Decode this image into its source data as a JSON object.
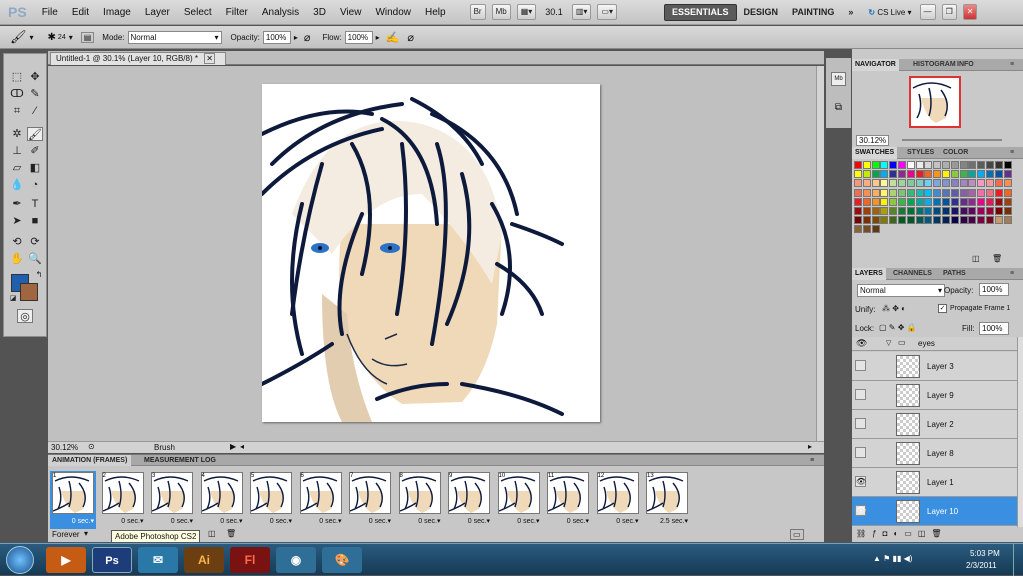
{
  "app": {
    "logo": "PS"
  },
  "menu": [
    "File",
    "Edit",
    "Image",
    "Layer",
    "Select",
    "Filter",
    "Analysis",
    "3D",
    "View",
    "Window",
    "Help"
  ],
  "menubar_buttons": {
    "bridge": "Br",
    "mini_bridge": "Mb",
    "zoom": "30.1",
    "workspaces": [
      "ESSENTIALS",
      "DESIGN",
      "PAINTING"
    ],
    "more": "»",
    "cs_live": "CS Live"
  },
  "options": {
    "brush_size": "24",
    "mode_label": "Mode:",
    "mode_value": "Normal",
    "opacity_label": "Opacity:",
    "opacity_value": "100%",
    "flow_label": "Flow:",
    "flow_value": "100%"
  },
  "document": {
    "tab_title": "Untitled-1 @ 30.1% (Layer 10, RGB/8) *",
    "status_zoom": "30.12%",
    "status_info": "Brush"
  },
  "animation": {
    "tabs": [
      "ANIMATION (FRAMES)",
      "MEASUREMENT LOG"
    ],
    "frames": [
      {
        "num": "1",
        "dur": "0 sec."
      },
      {
        "num": "2",
        "dur": "0 sec."
      },
      {
        "num": "3",
        "dur": "0 sec."
      },
      {
        "num": "4",
        "dur": "0 sec."
      },
      {
        "num": "5",
        "dur": "0 sec."
      },
      {
        "num": "6",
        "dur": "0 sec."
      },
      {
        "num": "7",
        "dur": "0 sec."
      },
      {
        "num": "8",
        "dur": "0 sec."
      },
      {
        "num": "9",
        "dur": "0 sec."
      },
      {
        "num": "10",
        "dur": "0 sec."
      },
      {
        "num": "11",
        "dur": "0 sec."
      },
      {
        "num": "12",
        "dur": "0 sec."
      },
      {
        "num": "13",
        "dur": "2.5 sec."
      }
    ],
    "loop": "Forever"
  },
  "tooltip": "Adobe Photoshop CS2",
  "navigator": {
    "tabs": [
      "NAVIGATOR",
      "HISTOGRAM",
      "INFO"
    ],
    "zoom": "30.12%"
  },
  "swatches": {
    "tabs": [
      "SWATCHES",
      "STYLES",
      "COLOR"
    ]
  },
  "layers": {
    "tabs": [
      "LAYERS",
      "CHANNELS",
      "PATHS"
    ],
    "blend": "Normal",
    "opacity_label": "Opacity:",
    "opacity_value": "100%",
    "unify_label": "Unify:",
    "propagate_label": "Propagate Frame 1",
    "lock_label": "Lock:",
    "fill_label": "Fill:",
    "fill_value": "100%",
    "group_name": "eyes",
    "items": [
      {
        "name": "Layer 3"
      },
      {
        "name": "Layer 9"
      },
      {
        "name": "Layer 2"
      },
      {
        "name": "Layer 8"
      },
      {
        "name": "Layer 1"
      },
      {
        "name": "Layer 10"
      }
    ]
  },
  "taskbar": {
    "apps": [
      "Ai",
      "Fl"
    ],
    "time": "5:03 PM",
    "date": "2/3/2011"
  },
  "colors": {
    "foreground": "#1f5fae",
    "background": "#a0663f",
    "selection": "#3a8fe0"
  }
}
